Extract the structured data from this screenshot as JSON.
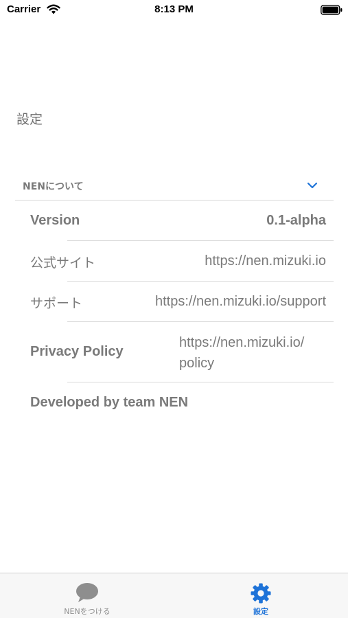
{
  "status_bar": {
    "carrier": "Carrier",
    "time": "8:13 PM"
  },
  "page": {
    "title": "設定"
  },
  "section": {
    "header": "NENについて",
    "rows": [
      {
        "label": "Version",
        "value": "0.1-alpha"
      },
      {
        "label": "公式サイト",
        "value": "https://nen.mizuki.io"
      },
      {
        "label": "サポート",
        "value": "https://nen.mizuki.io/support"
      },
      {
        "label": "Privacy Policy",
        "value_line1": "https://nen.mizuki.io/",
        "value_line2": "policy"
      },
      {
        "label": "Developed by team NEN"
      }
    ]
  },
  "tab_bar": {
    "tabs": [
      {
        "label": "NENをつける",
        "icon": "speech-bubble-icon",
        "color": "#8e8e8e"
      },
      {
        "label": "設定",
        "icon": "gear-icon",
        "color": "#1e73d8",
        "selected": true
      }
    ]
  },
  "colors": {
    "accent": "#1e73d8",
    "text_gray": "#7a7a7a",
    "separator": "#d9d9d9"
  }
}
